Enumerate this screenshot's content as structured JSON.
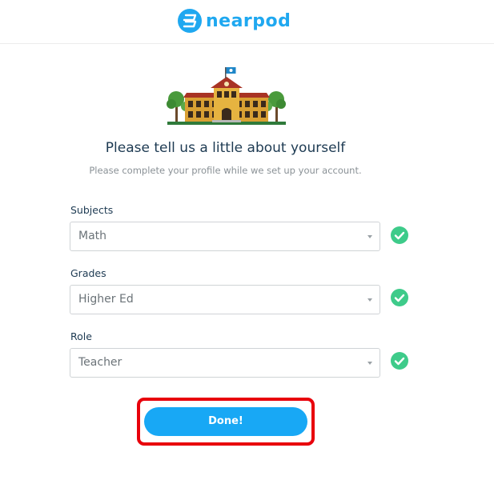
{
  "header": {
    "logo_text": "nearpod",
    "logo_icon": "nearpod-logo-icon",
    "brand_color": "#1fa8f0"
  },
  "illustration": {
    "icon": "school-building-icon"
  },
  "main": {
    "heading": "Please tell us a little about yourself",
    "subheading": "Please complete your profile while we set up your account."
  },
  "form": {
    "subjects": {
      "label": "Subjects",
      "value": "Math"
    },
    "grades": {
      "label": "Grades",
      "value": "Higher Ed"
    },
    "role": {
      "label": "Role",
      "value": "Teacher"
    },
    "check_color": "#3ecb8a"
  },
  "actions": {
    "done_label": "Done!",
    "button_color": "#18a8f5",
    "highlight_color": "#e8000b"
  }
}
